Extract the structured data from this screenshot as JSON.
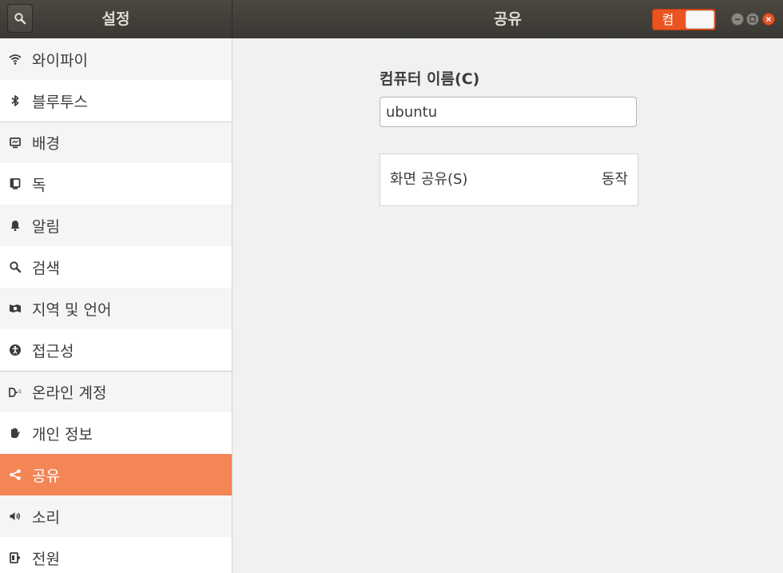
{
  "header": {
    "left_title": "설정",
    "right_title": "공유",
    "toggle_label": "켬"
  },
  "sidebar": {
    "items": [
      {
        "label": "와이파이",
        "icon": "wifi-icon"
      },
      {
        "label": "블루투스",
        "icon": "bluetooth-icon"
      },
      {
        "label": "배경",
        "icon": "background-icon"
      },
      {
        "label": "독",
        "icon": "dock-icon"
      },
      {
        "label": "알림",
        "icon": "bell-icon"
      },
      {
        "label": "검색",
        "icon": "search-icon"
      },
      {
        "label": "지역 및 언어",
        "icon": "region-icon"
      },
      {
        "label": "접근성",
        "icon": "accessibility-icon"
      },
      {
        "label": "온라인 계정",
        "icon": "online-accounts-icon"
      },
      {
        "label": "개인 정보",
        "icon": "privacy-hand-icon"
      },
      {
        "label": "공유",
        "icon": "share-icon",
        "selected": true
      },
      {
        "label": "소리",
        "icon": "speaker-icon"
      },
      {
        "label": "전원",
        "icon": "power-icon"
      }
    ]
  },
  "main": {
    "computer_name_label": "컴퓨터 이름(C)",
    "computer_name_value": "ubuntu",
    "screen_sharing_label": "화면 공유(S)",
    "screen_sharing_status": "동작"
  },
  "colors": {
    "accent": "#e95420",
    "selected_row": "#f48555",
    "titlebar": "#3e3b36"
  }
}
